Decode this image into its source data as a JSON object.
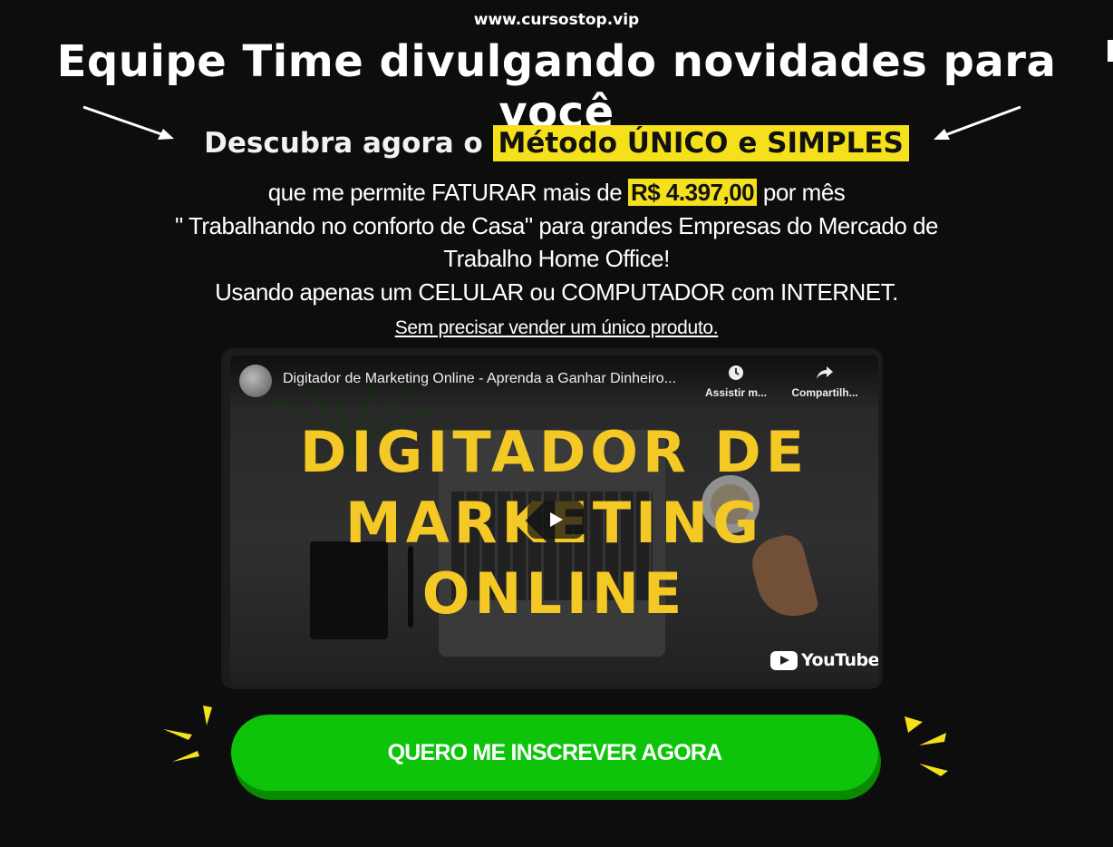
{
  "header": {
    "site_url": "www.cursostop.vip",
    "title": "Equipe Time divulgando novidades para você"
  },
  "headline": {
    "prefix": "Descubra agora o",
    "highlight": "Método ÚNICO e SIMPLES"
  },
  "body": {
    "line1_prefix": "que me permite FATURAR mais de",
    "line1_highlight": "R$ 4.397,00",
    "line1_suffix": "por mês",
    "line2": "\" Trabalhando no conforto de Casa\" para grandes Empresas do Mercado de",
    "line3": "Trabalho Home Office!",
    "line4": "Usando apenas um CELULAR ou COMPUTADOR com INTERNET."
  },
  "subline": "Sem precisar vender um único produto.",
  "video": {
    "caption": "Digitador de Marketing Online - Aprenda a Ganhar Dinheiro...",
    "watch_label": "Assistir m...",
    "share_label": "Compartilh...",
    "overlay_line1": "DIGITADOR DE",
    "overlay_line2": "MARKETING",
    "overlay_line3": "ONLINE",
    "brand": "YouTube"
  },
  "cta": {
    "label": "QUERO ME INSCREVER AGORA"
  },
  "colors": {
    "background": "#0d0d0d",
    "highlight": "#f5e11b",
    "cta_green": "#0dc40a",
    "overlay_text": "#f4c825"
  }
}
